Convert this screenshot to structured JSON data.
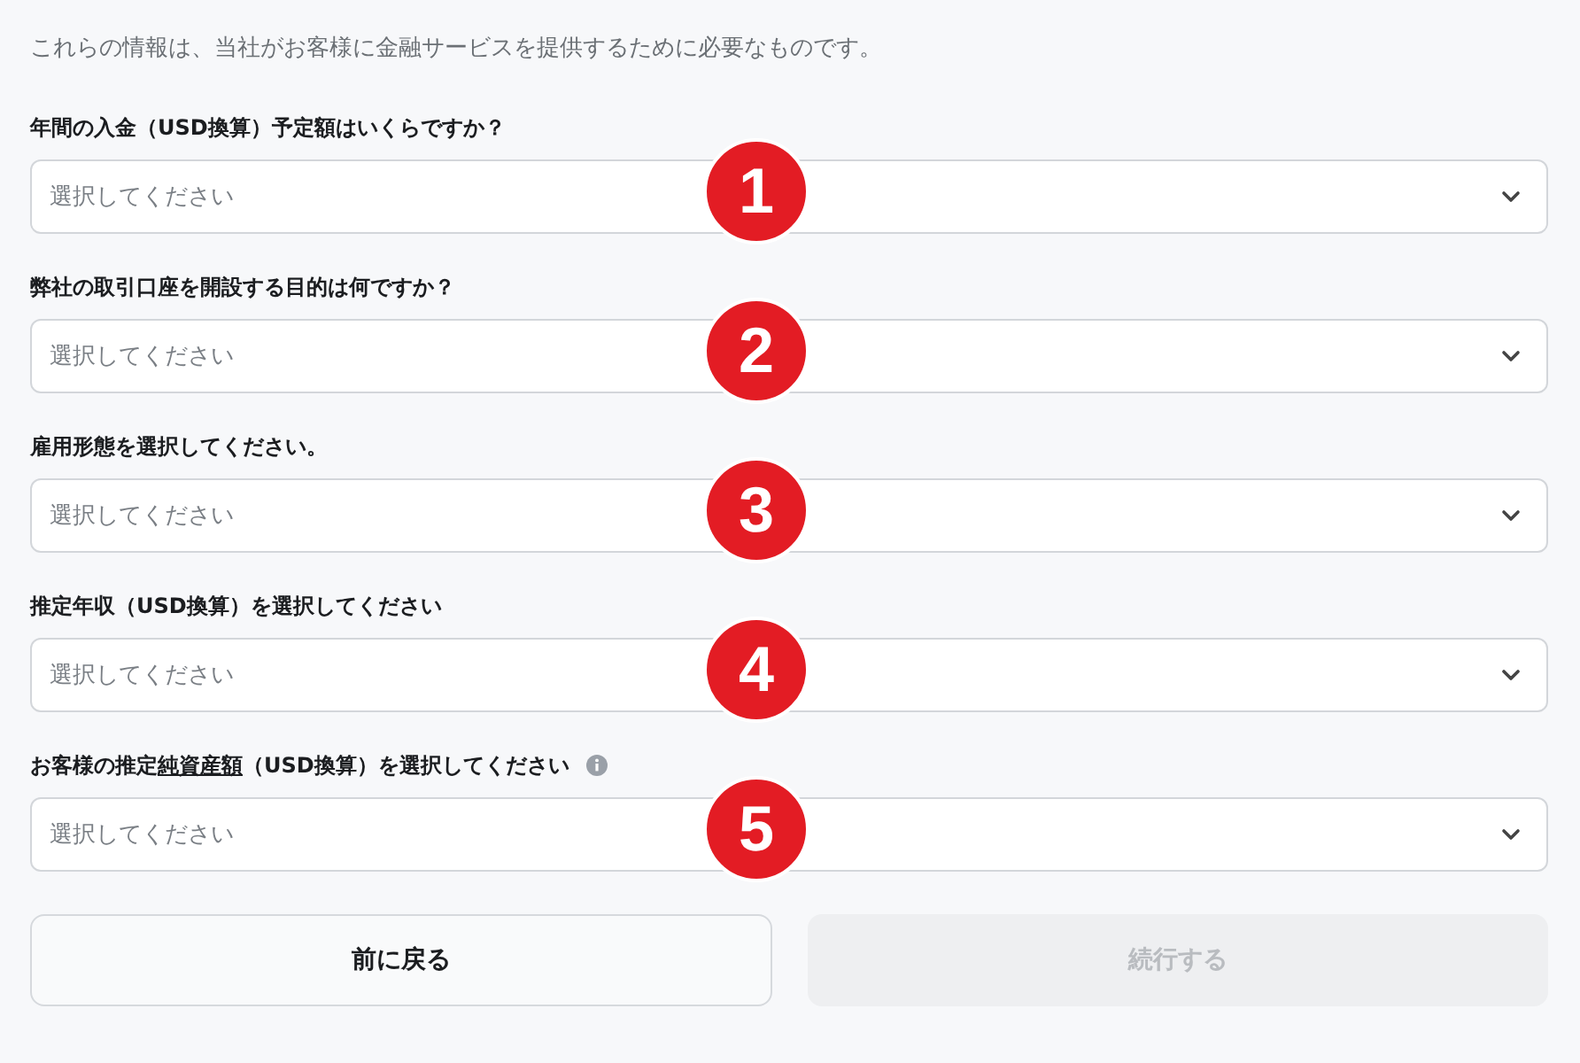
{
  "intro": "これらの情報は、当社がお客様に金融サービスを提供するために必要なものです。",
  "fields": [
    {
      "label": "年間の入金（USD換算）予定額はいくらですか？",
      "placeholder": "選択してください",
      "marker": "1"
    },
    {
      "label": "弊社の取引口座を開設する目的は何ですか？",
      "placeholder": "選択してください",
      "marker": "2"
    },
    {
      "label": "雇用形態を選択してください。",
      "placeholder": "選択してください",
      "marker": "3"
    },
    {
      "label": "推定年収（USD換算）を選択してください",
      "placeholder": "選択してください",
      "marker": "4"
    },
    {
      "label": "お客様の推定",
      "label_link": "純資産額",
      "label_suffix": "（USD換算）を選択してください",
      "info": true,
      "placeholder": "選択してください",
      "marker": "5"
    }
  ],
  "buttons": [
    {
      "label": "前に戻る",
      "disabled": false
    },
    {
      "label": "続行する",
      "disabled": true
    }
  ]
}
